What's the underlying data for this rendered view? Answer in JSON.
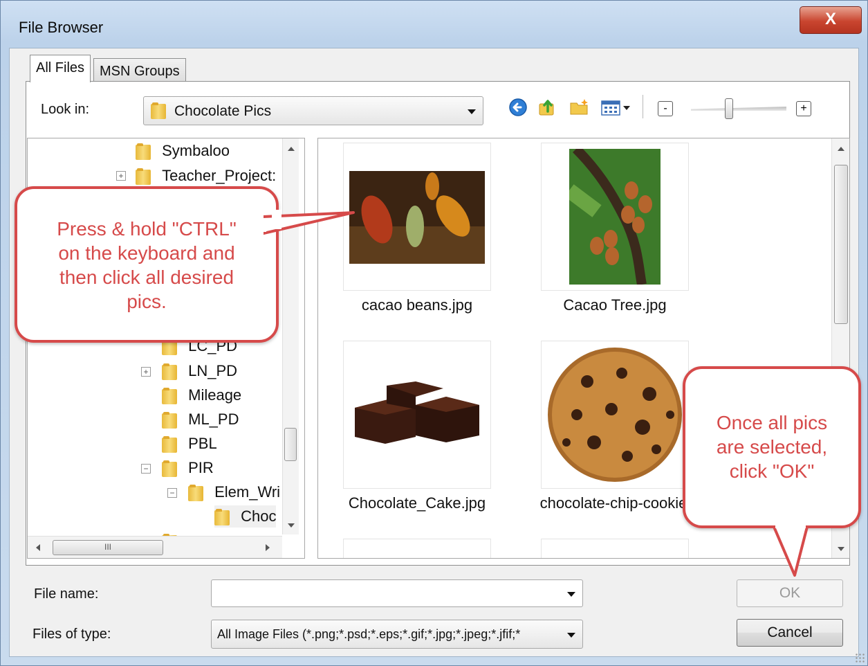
{
  "window": {
    "title": "File Browser",
    "close_label": "X"
  },
  "tabs": [
    {
      "label": "All Files",
      "active": true
    },
    {
      "label": "MSN Groups",
      "active": false
    }
  ],
  "look_in": {
    "label": "Look in:",
    "value": "Chocolate Pics"
  },
  "toolbar": {
    "icons": [
      "back-icon",
      "up-folder-icon",
      "new-folder-icon",
      "view-menu-icon"
    ],
    "zoom_minus": "-",
    "zoom_plus": "+",
    "zoom_level": 0.4
  },
  "tree": {
    "items": [
      {
        "label": "Symbaloo",
        "expander": ""
      },
      {
        "label": "Teacher_Project:",
        "expander": "+"
      },
      {
        "label": "LC_PD",
        "expander": ""
      },
      {
        "label": "LN_PD",
        "expander": "+"
      },
      {
        "label": "Mileage",
        "expander": ""
      },
      {
        "label": "ML_PD",
        "expander": ""
      },
      {
        "label": "PBL",
        "expander": ""
      },
      {
        "label": "PIR",
        "expander": "−"
      },
      {
        "label": "Elem_Wri",
        "expander": "−"
      },
      {
        "label": "Choc",
        "expander": ""
      }
    ],
    "hscroll_grip": "III"
  },
  "files": [
    {
      "name": "cacao beans.jpg",
      "image": "cacao-pods-photo"
    },
    {
      "name": "Cacao Tree.jpg",
      "image": "cacao-tree-photo"
    },
    {
      "name": "Chocolate_Cake.jpg",
      "image": "chocolate-cake-photo"
    },
    {
      "name": "chocolate-chip-cookie",
      "image": "cookie-photo"
    }
  ],
  "file_name": {
    "label": "File name:",
    "value": ""
  },
  "file_type": {
    "label": "Files of type:",
    "value": "All Image Files (*.png;*.psd;*.eps;*.gif;*.jpg;*.jpeg;*.jfif;*"
  },
  "buttons": {
    "ok": "OK",
    "cancel": "Cancel"
  },
  "callouts": {
    "left": [
      "Press & hold \"CTRL\"",
      "on the keyboard and",
      "then click all desired",
      "pics."
    ],
    "right": [
      "Once all pics",
      "are selected,",
      "click \"OK\""
    ]
  },
  "colors": {
    "callout_red": "#d64a4a",
    "title_bar": "#bcd2ea"
  }
}
